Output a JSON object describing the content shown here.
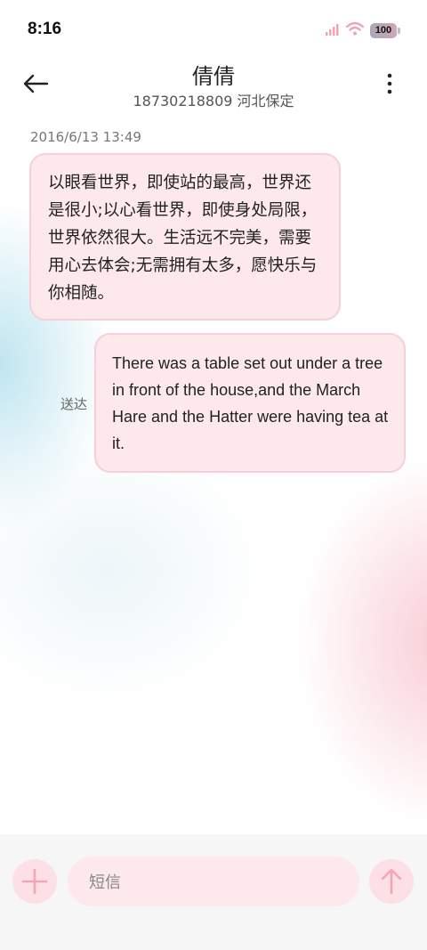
{
  "status_bar": {
    "time": "8:16",
    "battery": "100",
    "icons": [
      "signal-icon",
      "wifi-icon",
      "battery-icon"
    ]
  },
  "header": {
    "contact_name": "倩倩",
    "contact_detail": "18730218809 河北保定",
    "icons": [
      "back-arrow-icon",
      "more-vertical-icon"
    ]
  },
  "conversation": {
    "timestamp": "2016/6/13 13:49",
    "messages": [
      {
        "direction": "incoming",
        "text": "以眼看世界，即使站的最高，世界还是很小;以心看世界，即使身处局限，世界依然很大。生活远不完美，需要用心去体会;无需拥有太多，愿快乐与你相随。"
      },
      {
        "direction": "outgoing",
        "status": "送达",
        "text": "There was a table set out under a tree in front of the house,and the March Hare and the Hatter were having tea at it."
      }
    ]
  },
  "composer": {
    "placeholder": "短信",
    "icons": [
      "plus-icon",
      "send-arrow-icon"
    ]
  },
  "colors": {
    "bubble_fill": "#fde8ec",
    "bubble_border": "#f8cfd8",
    "accent_pink": "#f3a6b6",
    "bottom_bar": "#f6f6f6"
  }
}
